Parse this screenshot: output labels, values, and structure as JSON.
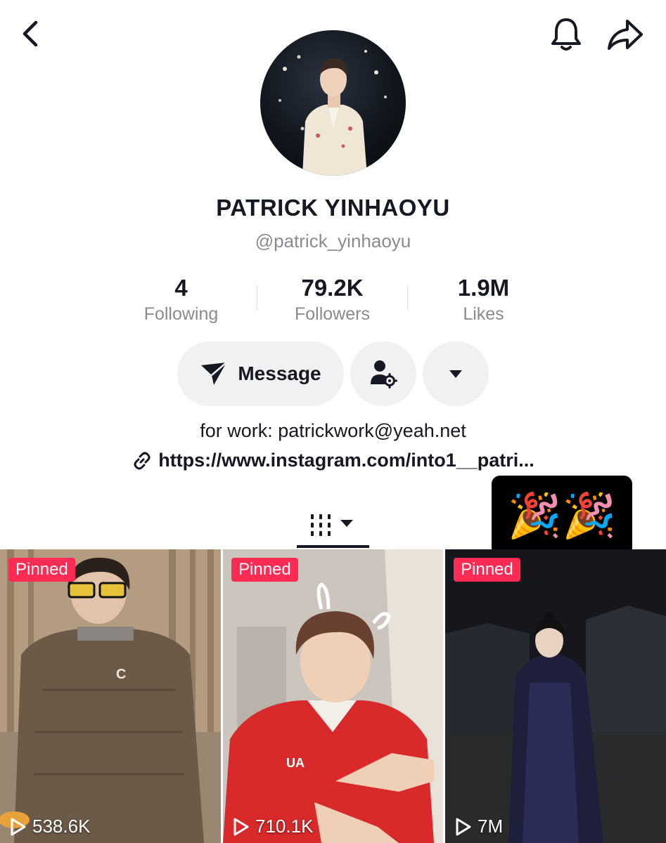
{
  "profile": {
    "display_name": "PATRICK YINHAOYU",
    "username": "@patrick_yinhaoyu"
  },
  "stats": [
    {
      "value": "4",
      "label": "Following"
    },
    {
      "value": "79.2K",
      "label": "Followers"
    },
    {
      "value": "1.9M",
      "label": "Likes"
    }
  ],
  "actions": {
    "message_label": "Message"
  },
  "bio": {
    "text": "for work: patrickwork@yeah.net",
    "link": "https://www.instagram.com/into1__patri..."
  },
  "popup": {
    "emoji": "🎉🎉"
  },
  "videos": [
    {
      "badge": "Pinned",
      "views": "538.6K"
    },
    {
      "badge": "Pinned",
      "views": "710.1K"
    },
    {
      "badge": "Pinned",
      "views": "7M"
    }
  ],
  "icons": {
    "back": "back-chevron-icon",
    "bell": "bell-icon",
    "share": "share-arrow-icon",
    "send": "send-icon",
    "add_friend": "user-settings-icon",
    "dropdown": "caret-down-icon",
    "link": "link-icon",
    "videos_tab": "videos-grid-icon",
    "play": "play-icon"
  },
  "colors": {
    "accent": "#fe2c55",
    "text": "#161823",
    "muted": "#8a8b91",
    "button_bg": "#f1f1f2"
  }
}
